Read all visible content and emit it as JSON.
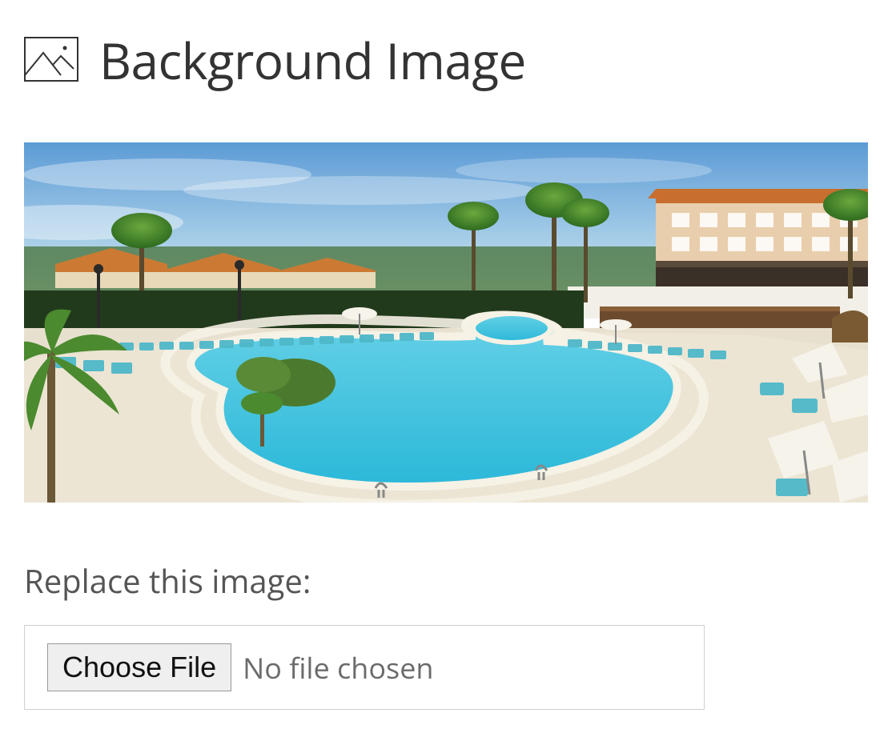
{
  "section": {
    "title": "Background Image",
    "icon": "image-icon"
  },
  "preview": {
    "alt": "Resort pool with palm trees and hotel buildings"
  },
  "replace": {
    "label": "Replace this image:",
    "button_label": "Choose File",
    "status_text": "No file chosen"
  }
}
